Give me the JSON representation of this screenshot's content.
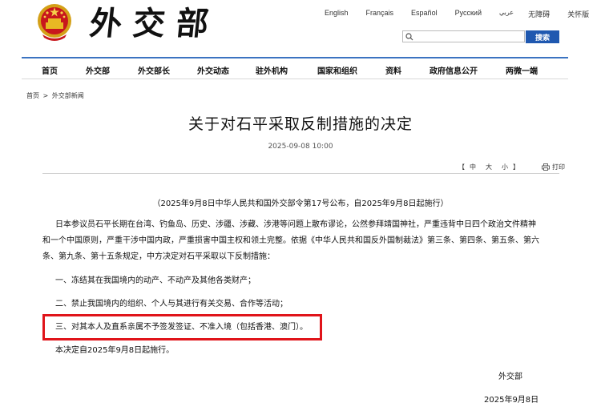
{
  "header": {
    "logo_text": "外交部",
    "languages": [
      "English",
      "Français",
      "Español",
      "Русский",
      "عربي",
      "无障碍",
      "关怀版"
    ],
    "search": {
      "placeholder": "",
      "button_label": "搜索"
    }
  },
  "nav": {
    "items": [
      "首页",
      "外交部",
      "外交部长",
      "外交动态",
      "驻外机构",
      "国家和组织",
      "资料",
      "政府信息公开",
      "两微一端"
    ]
  },
  "breadcrumb": {
    "home": "首页",
    "separator": ">",
    "section": "外交部新闻"
  },
  "article": {
    "title": "关于对石平采取反制措施的决定",
    "date": "2025-09-08 10:00",
    "font_tools": {
      "open": "【",
      "large": "中",
      "medium": "大",
      "small": "小",
      "close": "】",
      "print": "打印"
    },
    "preamble": "（2025年9月8日中华人民共和国外交部令第17号公布，自2025年9月8日起施行）",
    "intro_lines": [
      "日本参议员石平长期在台湾、钓鱼岛、历史、涉疆、涉藏、涉港等问题上散布谬论，公然参拜靖国神社，严重违背中日四个政治文件精神",
      "和一个中国原则，严重干涉中国内政，严重损害中国主权和领土完整。依据《中华人民共和国反外国制裁法》第三条、第四条、第五条、第六",
      "条、第九条、第十五条规定，中方决定对石平采取以下反制措施："
    ],
    "measures": [
      "一、冻结其在我国境内的动产、不动产及其他各类财产；",
      "二、禁止我国境内的组织、个人与其进行有关交易、合作等活动；",
      "三、对其本人及直系亲属不予签发签证、不准入境（包括香港、澳门）。"
    ],
    "effective": "本决定自2025年9月8日起施行。",
    "signature_org": "外交部",
    "signature_date": "2025年9月8日"
  },
  "colors": {
    "nav_border": "#3b73c1",
    "search_button": "#1f58b0",
    "highlight_box": "#e0141a"
  }
}
